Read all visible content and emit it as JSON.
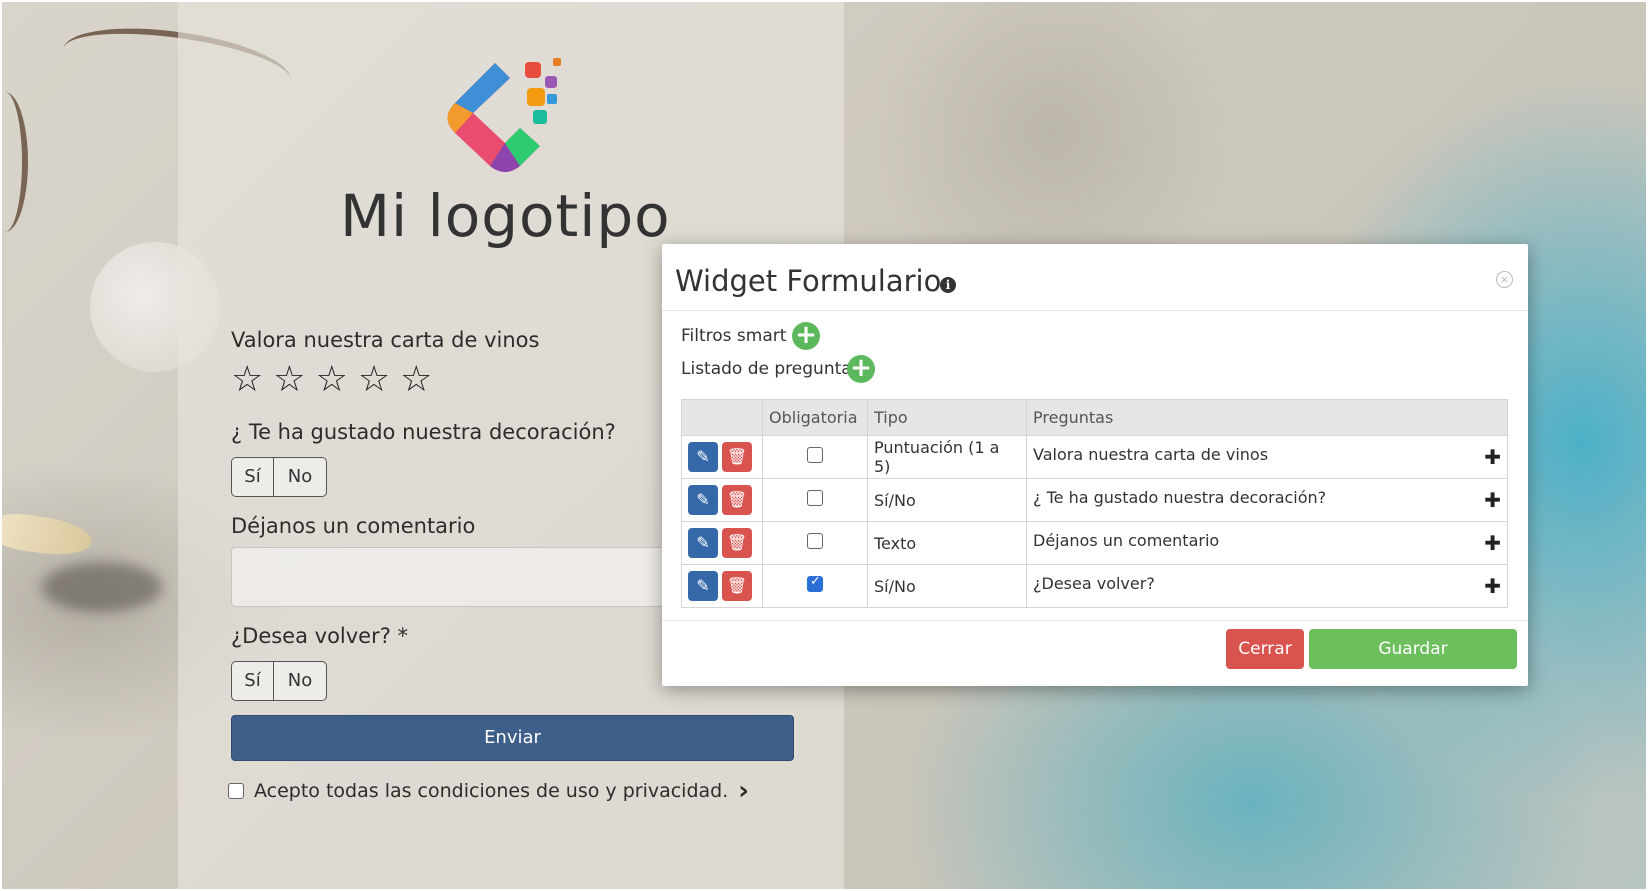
{
  "logo": {
    "text": "Mi logotipo"
  },
  "form": {
    "q1_label": "Valora nuestra carta de vinos",
    "stars": [
      "☆",
      "☆",
      "☆",
      "☆",
      "☆"
    ],
    "q2_label": "¿ Te ha gustado nuestra decoración?",
    "yes": "Sí",
    "no": "No",
    "q3_label": "Déjanos un comentario",
    "q4_label": "¿Desea volver? *",
    "send": "Enviar",
    "accept": "Acepto todas las condiciones de uso y privacidad.",
    "accept_chevron": "›"
  },
  "modal": {
    "title": "Widget Formulario",
    "info": "i",
    "close": "×",
    "smart_filters": "Filtros smart",
    "questions_list": "Listado de preguntas",
    "add": "+",
    "columns": {
      "actions": "",
      "required": "Obligatoria",
      "type": "Tipo",
      "questions": "Preguntas"
    },
    "rows": [
      {
        "required": false,
        "type": "Puntuación (1 a 5)",
        "question": "Valora nuestra carta de vinos"
      },
      {
        "required": false,
        "type": "Sí/No",
        "question": "¿ Te ha gustado nuestra decoración?"
      },
      {
        "required": false,
        "type": "Texto",
        "question": "Déjanos un comentario"
      },
      {
        "required": true,
        "type": "Sí/No",
        "question": "¿Desea volver?"
      }
    ],
    "edit_icon": "✎",
    "delete_icon": "🗑",
    "move_icon": "✚",
    "cancel_button": "Cerrar",
    "save_button": "Guardar"
  },
  "colors": {
    "primary": "#3e5f8a",
    "danger": "#d9534f",
    "success": "#6cbf5c",
    "add": "#5cb85c"
  }
}
